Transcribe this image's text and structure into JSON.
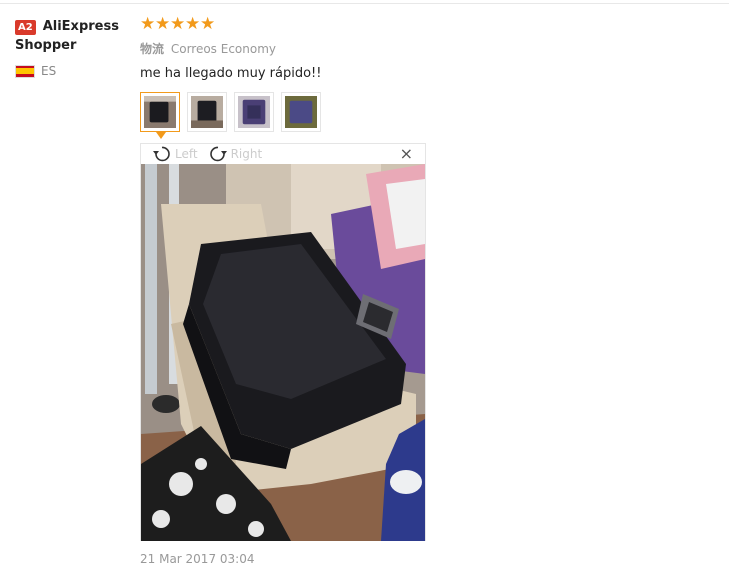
{
  "user": {
    "badge": "A2",
    "name_line1": "AliExpress",
    "name_line2": "Shopper",
    "country_code": "ES",
    "flag_icon": "spain-flag-icon"
  },
  "review": {
    "rating": 5,
    "stars": [
      "★",
      "★",
      "★",
      "★",
      "★"
    ],
    "shipping_label": "物流",
    "shipping_method": "Correos Economy",
    "comment": "me ha llegado muy rápido!!",
    "date": "21 Mar 2017 03:04",
    "star_color": "#f29a1b"
  },
  "viewer": {
    "rotate_left_label": "Left",
    "rotate_right_label": "Right",
    "close_glyph": "×"
  }
}
